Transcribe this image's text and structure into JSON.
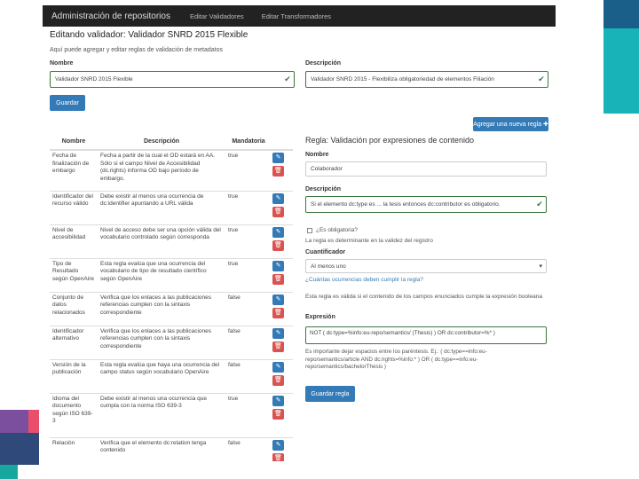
{
  "navbar": {
    "brand": "Administración de repositorios",
    "links": [
      "Editar Validadores",
      "Editar Transformadores"
    ]
  },
  "page": {
    "title": "Editando validador: Validador SNRD 2015 Flexible",
    "subtitle": "Aquí puede agregar y editar reglas de validación de metadatos"
  },
  "form": {
    "name_label": "Nombre",
    "name_value": "Validador SNRD 2015 Flexible",
    "desc_label": "Descripción",
    "desc_value": "Validador SNRD 2015 - Flexibiliza obligatoriedad de elementos Filiación",
    "save_label": "Guardar",
    "add_rule_label": "Agregar una nueva regla ✚"
  },
  "table": {
    "headers": [
      "Nombre",
      "Descripción",
      "Mandatoria"
    ],
    "rows": [
      {
        "name": "Fecha de finalización de embargo",
        "desc": "Fecha a partir de la cual el OD estará en AA. Sólo si el campo Nivel de Accesibilidad (dc.rights) informa OD bajo período de embargo.",
        "mand": "true"
      },
      {
        "name": "Identificador del recurso válido",
        "desc": "Debe existir al menos una ocurrencia de dc:identifier apuntando a URL válida",
        "mand": "true"
      },
      {
        "name": "Nivel de accesibilidad",
        "desc": "Nivel de acceso debe ser una opción válida del vocabulario controlado según corresponda",
        "mand": "true"
      },
      {
        "name": "Tipo de Resultado según OpenAire",
        "desc": "Esta regla evalúa que una ocurrencia del vocabulario de tipo de resultado científico según OpenAire",
        "mand": "true"
      },
      {
        "name": "Conjunto de datos relacionados",
        "desc": "Verifica que los enlaces a las publicaciones referencias cumplen con la sintaxis correspondiente",
        "mand": "false"
      },
      {
        "name": "Identificador alternativo",
        "desc": "Verifica que los enlaces a las publicaciones referencias cumplen con la sintaxis correspondiente",
        "mand": "false"
      },
      {
        "name": "Versión de la publicación",
        "desc": "Esta regla evalúa que haya una ocurrencia del campo status según vocabulario OpenAire",
        "mand": "false"
      },
      {
        "name": "Idioma del documento según ISO 639-3",
        "desc": "Debe existir al menos una ocurrencia que cumpla con la norma ISO 639-3",
        "mand": "true"
      },
      {
        "name": "Relación",
        "desc": "Verifica que el elemento dc:relation tenga contenido",
        "mand": "false"
      }
    ]
  },
  "rule": {
    "title": "Regla: Validación por expresiones de contenido",
    "name_label": "Nombre",
    "name_value": "Colaborador",
    "desc_label": "Descripción",
    "desc_value": "Si el elemento dc:type es ... la tesis entonces dc:contributor es obligatorio.",
    "mandatory_label": "¿Es obligatoria?",
    "mandatory_help": "La regla es determinante en la validez del registro",
    "quantifier_label": "Cuantificador",
    "quantifier_value": "Al menos uno",
    "quantifier_help": "¿Cuántas ocurrencias deben cumplir la regla?",
    "explain_text": "Esta regla es válida si el contenido de los campos enunciados cumple la expresión booleana",
    "expression_label": "Expresión",
    "expression_value": "NOT ( dc:type=%info:eu-repo/semantics/ (Thesis) ) OR dc:contributor=%* )",
    "expression_help": "Es importante dejar espacios entre los paréntesis. Ej.: ( dc:type==info:eu-repo/semantics/article AND dc:rights=%info:* ) OR ( dc:type==info:eu-repo/semantics/bachelorThesis )",
    "save_rule_label": "Guardar regla"
  }
}
